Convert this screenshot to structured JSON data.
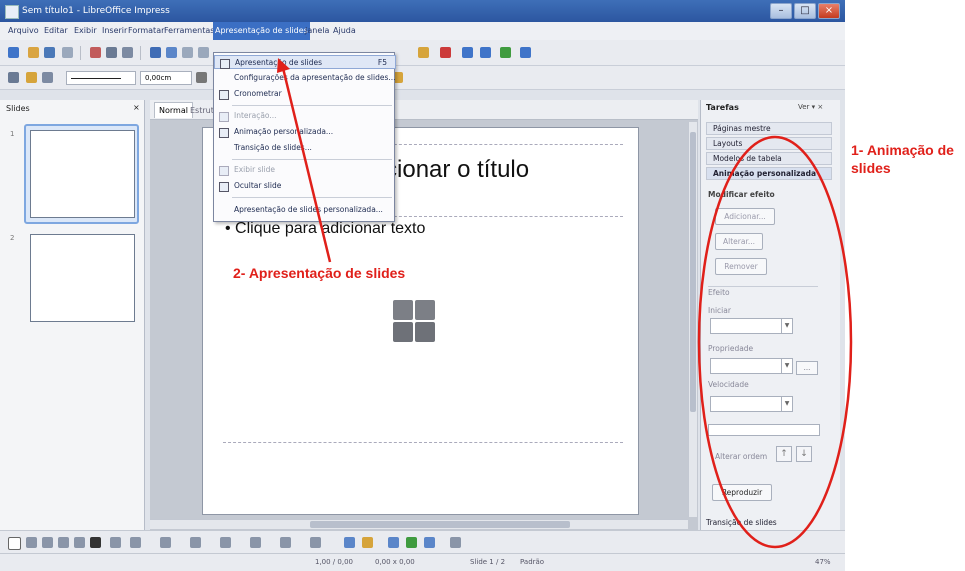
{
  "window": {
    "title": "Sem título1 - LibreOffice Impress",
    "min_label": "–",
    "max_label": "□",
    "close_label": "×"
  },
  "menubar": {
    "items": [
      "Arquivo",
      "Editar",
      "Exibir",
      "Inserir",
      "Formatar",
      "Ferramentas",
      "Apresentação de slides",
      "Janela",
      "Ajuda"
    ]
  },
  "toolbar": {
    "line_width": "0,00cm"
  },
  "slides_panel": {
    "title": "Slides",
    "close_label": "×",
    "thumb_numbers": [
      "1",
      "2"
    ]
  },
  "view_tabs": [
    "Normal",
    "Estrutura"
  ],
  "slide": {
    "title_placeholder": "adicionar o título",
    "text_placeholder": "• Clique para adicionar texto"
  },
  "slideshow_menu": {
    "items": [
      {
        "label": "Apresentação de slides",
        "shortcut": "F5"
      },
      {
        "label": "Configurações da apresentação de slides..."
      },
      {
        "label": "Cronometrar"
      },
      {
        "label": "Interação..."
      },
      {
        "label": "Animação personalizada..."
      },
      {
        "label": "Transição de slides..."
      },
      {
        "label": "Exibir slide"
      },
      {
        "label": "Ocultar slide"
      },
      {
        "label": "Apresentação de slides personalizada..."
      }
    ]
  },
  "task_panel": {
    "title": "Tarefas",
    "view_label": "Ver ▾ ×",
    "sections": [
      "Páginas mestre",
      "Layouts",
      "Modelos de tabela",
      "Animação personalizada"
    ],
    "modify_effect_label": "Modificar efeito",
    "add_button": "Adicionar...",
    "change_button": "Alterar...",
    "remove_button": "Remover",
    "effect_label": "Efeito",
    "start_label": "Iniciar",
    "property_label": "Propriedade",
    "speed_label": "Velocidade",
    "change_order_label": "Alterar ordem",
    "play_button": "Reproduzir",
    "footer_section": "Transição de slides"
  },
  "statusbar": {
    "position": "1,00 / 0,00",
    "size": "0,00 x 0,00",
    "slide_info": "Slide 1 / 2",
    "layout_name": "Padrão",
    "zoom": "47%"
  },
  "annotations": {
    "label1": "1- Animação de slides",
    "label2": "2- Apresentação de slides",
    "accent_color": "#e0201a"
  }
}
